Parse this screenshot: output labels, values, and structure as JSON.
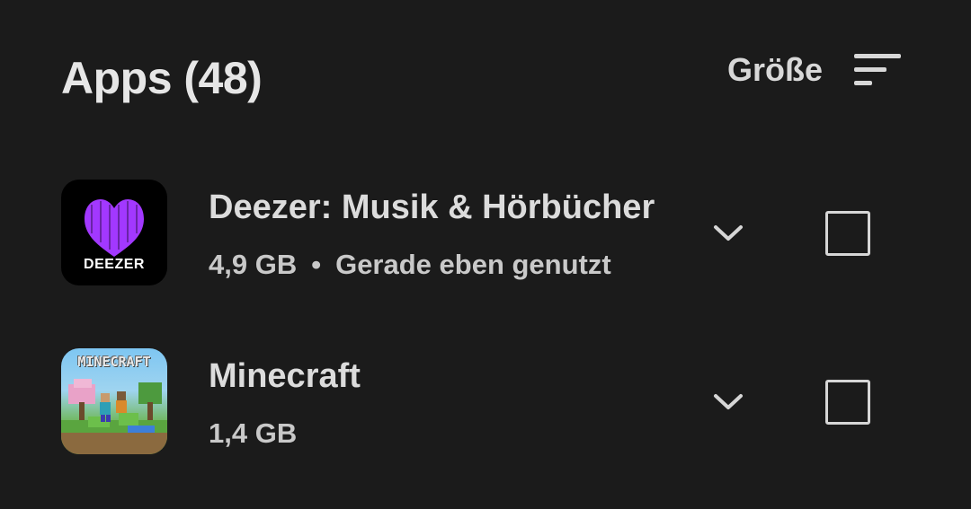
{
  "header": {
    "title": "Apps (48)",
    "sort_label": "Größe"
  },
  "apps": [
    {
      "name": "Deezer: Musik & Hörbücher",
      "size": "4,9 GB",
      "separator": "•",
      "last_used": "Gerade eben genutzt",
      "icon_text": "DEEZER",
      "icon": "deezer-logo",
      "checked": false
    },
    {
      "name": "Minecraft",
      "size": "1,4 GB",
      "icon_text": "MINECRAFT",
      "icon": "minecraft-logo",
      "checked": false
    }
  ],
  "colors": {
    "background": "#1b1b1b",
    "text_primary": "#e3e3e3",
    "deezer_purple": "#a238ff",
    "checkbox_border": "#d6d6d6"
  }
}
